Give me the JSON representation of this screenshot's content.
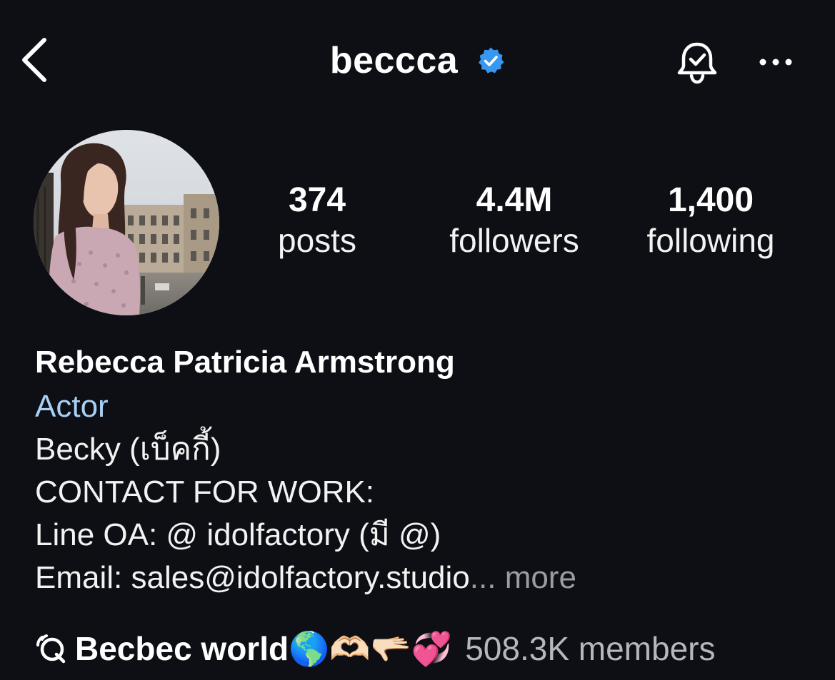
{
  "header": {
    "username": "beccca",
    "verified": true,
    "accent_color": "#3897f0"
  },
  "stats": {
    "posts": {
      "value": "374",
      "label": "posts"
    },
    "followers": {
      "value": "4.4M",
      "label": "followers"
    },
    "following": {
      "value": "1,400",
      "label": "following"
    }
  },
  "bio": {
    "full_name": "Rebecca Patricia Armstrong",
    "category": "Actor",
    "lines": [
      "Becky (เบ็คกี้)",
      "CONTACT FOR WORK:",
      "Line OA: @ idolfactory (มี @)",
      "Email: sales@idolfactory.studio"
    ],
    "ellipsis": "...",
    "more_label": "more"
  },
  "channel": {
    "name": "Becbec world🌎🫶🏻🫳🏻💞",
    "members": "508.3K members"
  },
  "icons": {
    "back": "chevron-left-icon",
    "verified": "verified-badge-icon",
    "notifications": "bell-check-icon",
    "more": "more-horizontal-icon",
    "channel": "broadcast-channel-icon"
  }
}
